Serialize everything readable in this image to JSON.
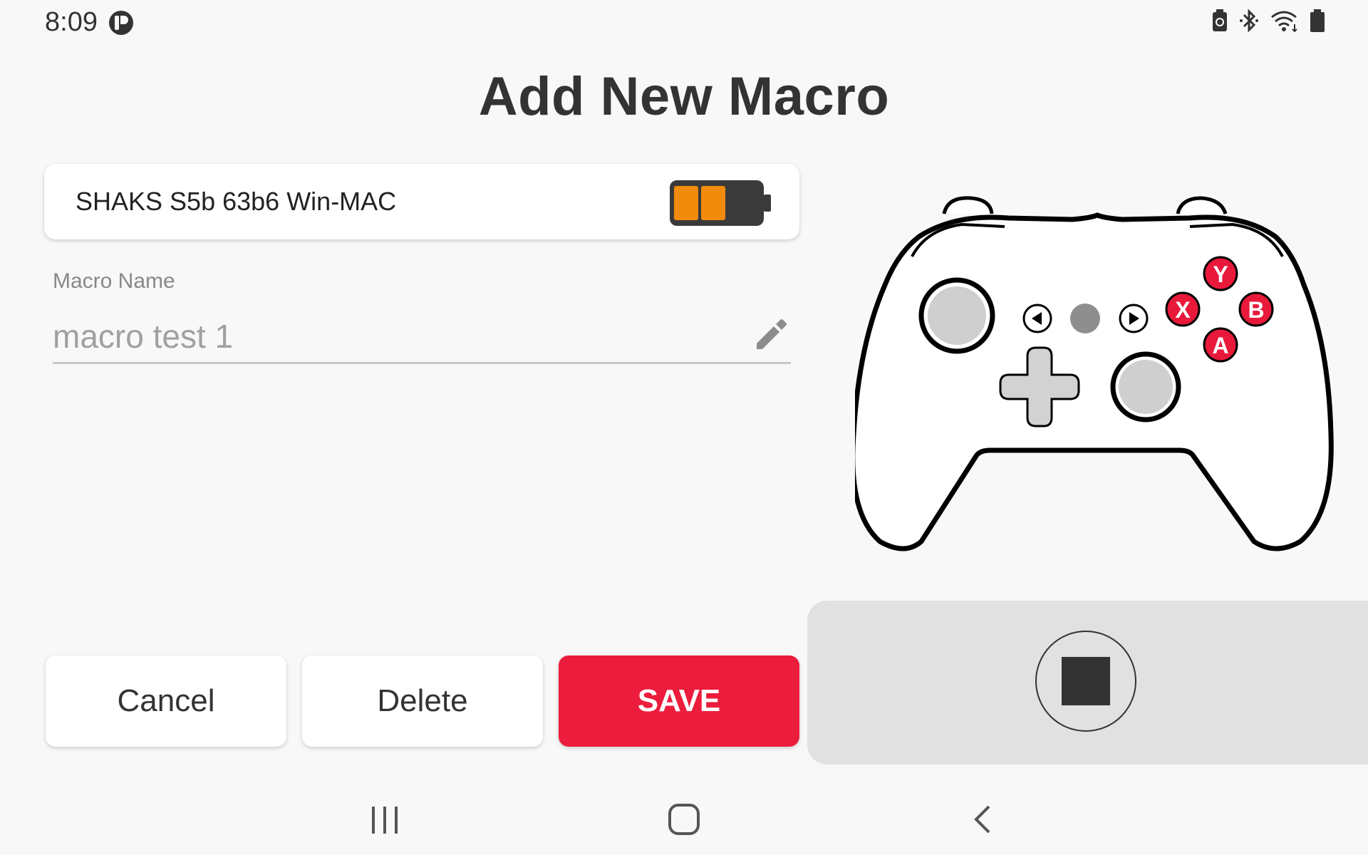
{
  "status_bar": {
    "time": "8:09",
    "app_icon": "app-badge-icon",
    "right_icons": [
      "battery-saver-icon",
      "bluetooth-icon",
      "wifi-icon",
      "battery-icon"
    ]
  },
  "page": {
    "title": "Add New Macro"
  },
  "device": {
    "name": "SHAKS S5b 63b6 Win-MAC",
    "battery_level": 0.66,
    "battery_color": "#f28a0c"
  },
  "macro_name": {
    "label": "Macro Name",
    "value": "",
    "placeholder": "macro test 1"
  },
  "buttons": {
    "cancel": "Cancel",
    "delete": "Delete",
    "save": "SAVE"
  },
  "controller": {
    "face_buttons": {
      "y": "Y",
      "x": "X",
      "b": "B",
      "a": "A"
    },
    "accent_color": "#e8193a"
  },
  "record": {
    "control": "stop"
  },
  "colors": {
    "accent": "#ec1c3c",
    "background": "#f8f8f8",
    "panel": "#e1e1e1"
  }
}
